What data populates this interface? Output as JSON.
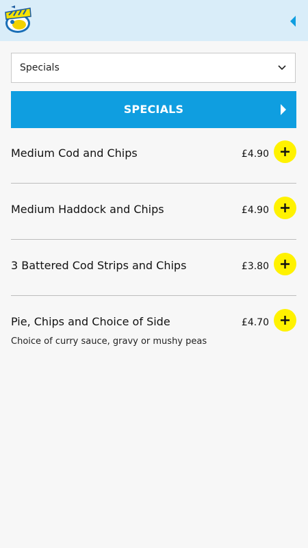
{
  "header": {
    "logo_icon": "the-chippy-logo",
    "back_icon": "triangle-left-icon",
    "accent_color": "#d9edf9"
  },
  "category_select": {
    "value": "Specials",
    "icon": "chevron-down-icon"
  },
  "section": {
    "title": "SPECIALS",
    "color": "#0f9ee0",
    "icon": "triangle-right-icon"
  },
  "items": [
    {
      "name": "Medium Cod and Chips",
      "price": "£4.90",
      "description": ""
    },
    {
      "name": "Medium Haddock and Chips",
      "price": "£4.90",
      "description": ""
    },
    {
      "name": "3 Battered Cod Strips and Chips",
      "price": "£3.80",
      "description": ""
    },
    {
      "name": "Pie, Chips and Choice of Side",
      "price": "£4.70",
      "description": "Choice of curry sauce, gravy or mushy peas"
    }
  ],
  "add_button_color": "#fff200"
}
